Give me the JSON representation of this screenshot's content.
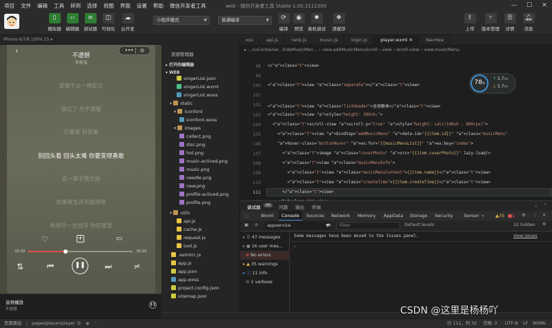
{
  "menu": [
    "项目",
    "文件",
    "编辑",
    "工具",
    "转到",
    "选择",
    "视图",
    "界面",
    "设置",
    "帮助",
    "微信开发者工具"
  ],
  "window_title": "web - 微信开发者工具 Stable 1.05.2111300",
  "toolbar": {
    "simulator": "模拟器",
    "editor": "编辑器",
    "debugger": "调试器",
    "visual": "可视化",
    "cloud": "云开发",
    "mode_select": "小程序模式",
    "compile_select": "普通编译",
    "compile": "编译",
    "preview": "预览",
    "real_debug": "真机调试",
    "clear_cache": "清缓存",
    "upload": "上传",
    "version": "版本管理",
    "details": "详情",
    "messages": "消息"
  },
  "simulator": {
    "header": "iPhone 6/7/8  100%  15 ▾",
    "song_title": "不遗憾",
    "singer": "李荣浩",
    "lyrics": [
      "爱情不止一种定义",
      "错过了 也不遗憾",
      "只要是 好答案",
      "别回头看 回头太难 你要变得勇敢",
      "这一辈子我欠你",
      "如果来生还可能继续",
      "再用尽一生找寻 你在哪里"
    ],
    "current_time": "01:52",
    "total_time": "05:26",
    "progress": 0.36,
    "mini_title": "音频播放",
    "mini_sub": "不遗憾"
  },
  "explorer": {
    "title": "资源管理器",
    "open_editors": "打开的编辑器",
    "root": "WEB",
    "items": [
      {
        "name": "singerList.json",
        "type": "json"
      },
      {
        "name": "singerList.wxml",
        "type": "wxml"
      },
      {
        "name": "singerList.wxss",
        "type": "wxss"
      },
      {
        "name": "static",
        "type": "folder"
      },
      {
        "name": "iconfont",
        "type": "folder"
      },
      {
        "name": "iconfont.wxss",
        "type": "wxss"
      },
      {
        "name": "images",
        "type": "folder"
      },
      {
        "name": "collect.png",
        "type": "png"
      },
      {
        "name": "disc.png",
        "type": "png"
      },
      {
        "name": "hot.png",
        "type": "png"
      },
      {
        "name": "music-actived.png",
        "type": "png"
      },
      {
        "name": "music.png",
        "type": "png"
      },
      {
        "name": "needle.png",
        "type": "png"
      },
      {
        "name": "new.png",
        "type": "png"
      },
      {
        "name": "profile-actived.png",
        "type": "png"
      },
      {
        "name": "profile.png",
        "type": "png"
      },
      {
        "name": "utils",
        "type": "folder"
      },
      {
        "name": "api.js",
        "type": "js"
      },
      {
        "name": "cache.js",
        "type": "js"
      },
      {
        "name": "request.js",
        "type": "js"
      },
      {
        "name": "tool.js",
        "type": "js"
      },
      {
        "name": ".eslintrc.js",
        "type": "js"
      },
      {
        "name": "app.js",
        "type": "js"
      },
      {
        "name": "app.json",
        "type": "json"
      },
      {
        "name": "app.wxss",
        "type": "wxss"
      },
      {
        "name": "project.config.json",
        "type": "json"
      },
      {
        "name": "sitemap.json",
        "type": "json"
      }
    ],
    "outline": "大纲"
  },
  "tabs": [
    "xss",
    "api.js",
    "rank.js",
    "music.js",
    "login.js",
    "player.wxml",
    "NavHea"
  ],
  "breadcrumb": "▸ ...nuContainer...hideMusicMen... › view.addMusicMenuScroll › view › scroll-view › view.musicMenu",
  "code": [
    {
      "ln": "",
      "text": "</view>"
    },
    {
      "ln": "",
      "text": ""
    },
    {
      "ln": "",
      "text": "<view class=\"separate\"></view>"
    },
    {
      "ln": "",
      "text": ""
    },
    {
      "ln": "",
      "text": "<view class=\"listHeader\">全部歌单</view>"
    },
    {
      "ln": "",
      "text": "<view style=\"height: 100vh;\">"
    },
    {
      "ln": "",
      "text": "  <scroll-view scroll-y=\"true\" style=\"height: calc(100vh - 800rpx)\">"
    },
    {
      "ln": "",
      "text": "    <view bindtap=\"addMusicMenu\" data-id=\"{{item.id}}\" class=\"musicMenu\""
    },
    {
      "ln": "",
      "text": "    hover-class=\"buttonHover\" wx:for=\"{{musicMenuList}}\" wx:key=\"index\">"
    },
    {
      "ln": "",
      "text": "      <image class=\"coverPhoto\" src=\"{{item.coverPhoto}}\" lazy-load/>"
    },
    {
      "ln": "",
      "text": "      <view class=\"musicMenuInfo\">"
    },
    {
      "ln": "",
      "text": "        <view class=\"musicMenuContent\">{{item.name}}</view>"
    },
    {
      "ln": "",
      "text": "        <view class=\"createTime\">{{item.createTime}}</view>"
    },
    {
      "ln": "111",
      "text": "      </view>"
    },
    {
      "ln": "",
      "text": "    </view>"
    }
  ],
  "perf": {
    "score": "78",
    "pct": "%",
    "v1": "5.7",
    "u1": "Mb",
    "v2": "5.7",
    "u2": "Mb"
  },
  "devtools": {
    "panel_tabs": [
      "调试器",
      "35",
      "问题",
      "输出",
      "终端"
    ],
    "tabs": [
      "Wxml",
      "Console",
      "Sources",
      "Network",
      "Memory",
      "AppData",
      "Storage",
      "Security",
      "Sensor"
    ],
    "badge_warn": "35",
    "badge_err": "1",
    "context": "appservice",
    "filter": "Filter",
    "levels": "Default levels",
    "hidden": "32 hidden",
    "sidebar": [
      {
        "label": "47 messages",
        "type": "list"
      },
      {
        "label": "16 user mes...",
        "type": "user"
      },
      {
        "label": "No errors",
        "type": "error"
      },
      {
        "label": "35 warnings",
        "type": "warn"
      },
      {
        "label": "11 info",
        "type": "info"
      },
      {
        "label": "1 verbose",
        "type": "verbose"
      }
    ],
    "message": "Some messages have been moved to the Issues panel.",
    "link": "View issues"
  },
  "statusbar": {
    "left": "页面路径",
    "path": "pages/player/player",
    "cursor": "行 111，列 32",
    "spaces": "空格: 2",
    "encoding": "UTF-8",
    "eol": "LF",
    "lang": "WXML"
  },
  "watermark": "CSDN @这里是杨杨吖"
}
